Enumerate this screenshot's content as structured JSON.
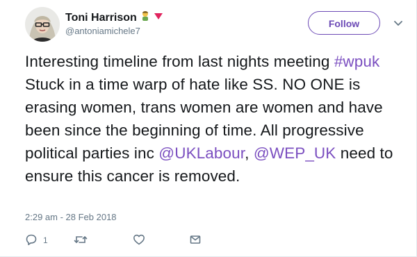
{
  "user": {
    "display_name": "Toni Harrison",
    "handle": "@antoniamichele7",
    "name_emojis": [
      "woman-emoji",
      "triangle-emoji"
    ]
  },
  "follow_button": {
    "label": "Follow"
  },
  "tweet": {
    "text_before_hashtag": "Interesting timeline from last nights meeting ",
    "hashtag": "#wpuk",
    "text_after_hashtag": " Stuck in a time warp of hate like SS. NO ONE is erasing women, trans women are women and have been since the beginning of time. All progressive political parties inc ",
    "mention1": "@UKLabour",
    "separator": ", ",
    "mention2": "@WEP_UK",
    "text_end": " need to ensure this cancer is removed."
  },
  "timestamp": "2:29 am - 28 Feb 2018",
  "actions": {
    "reply_count": "1",
    "icons": [
      "reply-icon",
      "retweet-icon",
      "like-icon",
      "message-icon"
    ]
  },
  "colors": {
    "link": "#7b4fc0",
    "follow_border": "#6b49b5",
    "muted": "#657786",
    "text": "#14171a"
  }
}
